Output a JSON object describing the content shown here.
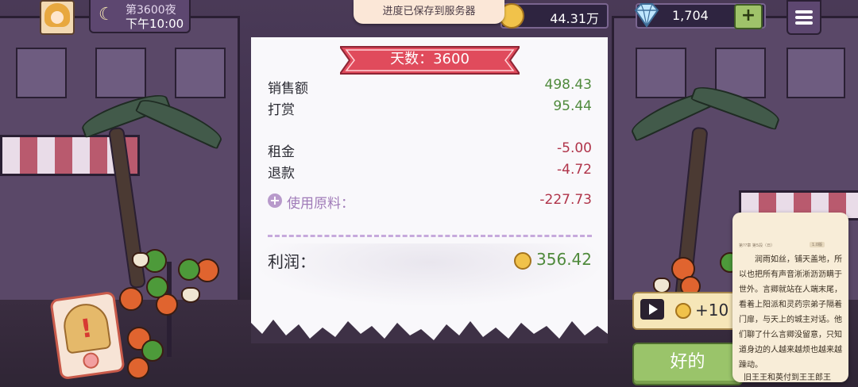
{
  "hud": {
    "day_label": "第3600夜",
    "time_label": "下午10:00",
    "coins": "44.31万",
    "gems": "1,704",
    "plus_label": "+"
  },
  "toast": "进度已保存到服务器",
  "receipt": {
    "ribbon_title": "天数：3600",
    "sales_label": "销售额",
    "sales_value": "498.43",
    "tips_label": "打赏",
    "tips_value": "95.44",
    "rent_label": "租金",
    "rent_value": "-5.00",
    "refund_label": "退款",
    "refund_value": "-4.72",
    "materials_label": "使用原料：",
    "materials_value": "-227.73",
    "profit_label": "利润：",
    "profit_value": "356.42"
  },
  "ad": {
    "reward": "+10"
  },
  "ok_button": "好的",
  "novel": {
    "header": "第??章 第5段（日）",
    "tag": "1.0版",
    "text": "润雨如丝，铺天盖地，所以也把所有声音淅淅沥沥瞒于世外。言卿就站在人端末尾，看着上阳派和灵药宗弟子隔着门扉，与天上的城主对话。他们聊了什么言卿没留意，只知道身边的人越来越烦也越来越躁动。",
    "more": "旧王王和英付到王王郎王"
  },
  "colors": {
    "profit_positive": "#4f8a3c",
    "expense_negative": "#b0344a",
    "ribbon": "#e04b5c",
    "ok_button": "#9ac46a"
  }
}
